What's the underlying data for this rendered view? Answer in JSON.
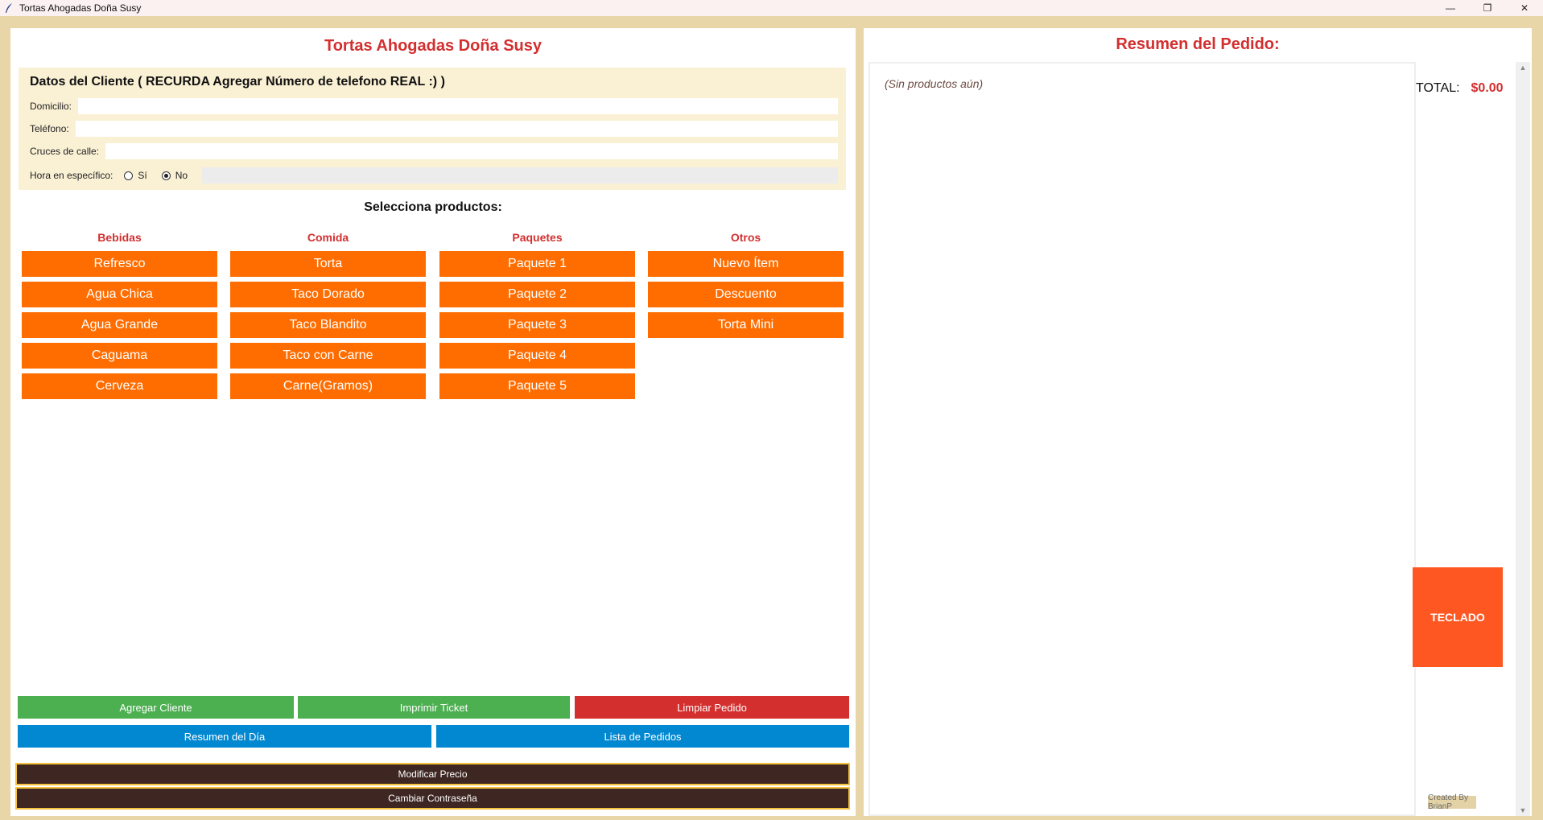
{
  "window": {
    "title": "Tortas Ahogadas Doña Susy",
    "minimize": "—",
    "restore": "❐",
    "close": "✕"
  },
  "left": {
    "app_title": "Tortas Ahogadas Doña Susy",
    "client": {
      "title": "Datos del Cliente ( RECURDA Agregar Número de telefono REAL :)  )",
      "domicilio_label": "Domicilio:",
      "domicilio_value": "",
      "telefono_label": "Teléfono:",
      "telefono_value": "",
      "cruces_label": "Cruces de calle:",
      "cruces_value": "",
      "hora_label": "Hora en específico:",
      "hora_si": "Sí",
      "hora_no": "No",
      "hora_selected": "No",
      "hora_value": ""
    },
    "products_title": "Selecciona productos:",
    "categories": [
      {
        "name": "Bebidas",
        "items": [
          "Refresco",
          "Agua Chica",
          "Agua Grande",
          "Caguama",
          "Cerveza"
        ]
      },
      {
        "name": "Comida",
        "items": [
          "Torta",
          "Taco Dorado",
          "Taco Blandito",
          "Taco con Carne",
          "Carne(Gramos)"
        ]
      },
      {
        "name": "Paquetes",
        "items": [
          "Paquete 1",
          "Paquete 2",
          "Paquete 3",
          "Paquete 4",
          "Paquete 5"
        ]
      },
      {
        "name": "Otros",
        "items": [
          "Nuevo Ítem",
          "Descuento",
          "Torta Mini"
        ]
      }
    ],
    "actions": {
      "agregar_cliente": "Agregar Cliente",
      "imprimir_ticket": "Imprimir Ticket",
      "limpiar_pedido": "Limpiar Pedido",
      "resumen_dia": "Resumen del Día",
      "lista_pedidos": "Lista de Pedidos",
      "modificar_precio": "Modificar Precio",
      "cambiar_contrasena": "Cambiar Contraseña"
    }
  },
  "right": {
    "summary_title": "Resumen del Pedido:",
    "empty_text": "(Sin productos aún)",
    "total_label": "TOTAL:",
    "total_value": "$0.00",
    "teclado": "TECLADO",
    "credit": "Created By BrianP"
  },
  "colors": {
    "accent_red": "#d32f2f",
    "product_orange": "#ff6d00",
    "teclado_orange": "#ff5722",
    "green": "#4caf50",
    "blue": "#0288d1",
    "dark_brown": "#3e2723",
    "background_tan": "#e9d6a8"
  }
}
